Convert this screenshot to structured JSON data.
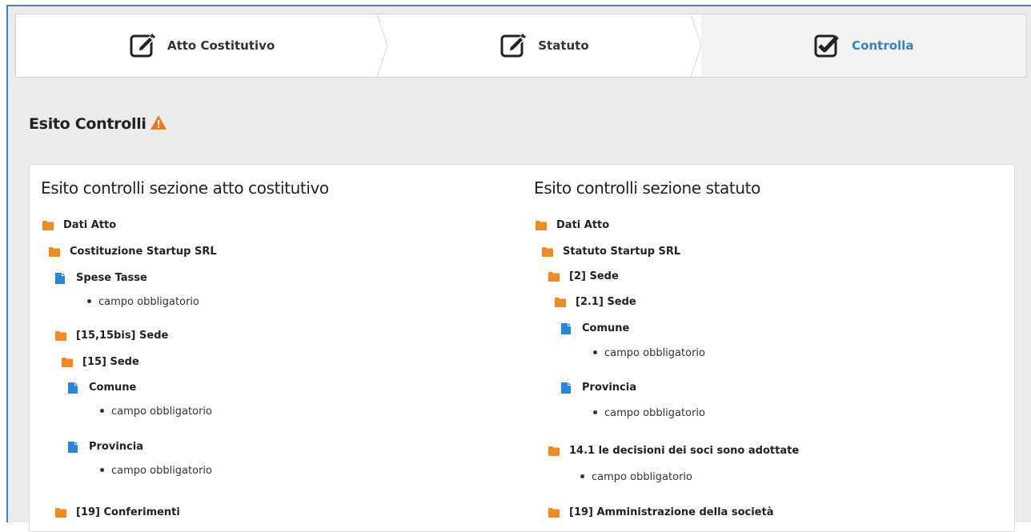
{
  "wizard": {
    "steps": [
      {
        "label": "Atto Costitutivo",
        "icon": "edit-icon"
      },
      {
        "label": "Statuto",
        "icon": "edit-icon"
      },
      {
        "label": "Controlla",
        "icon": "check-square-icon"
      }
    ]
  },
  "page_title": "Esito Controlli",
  "colors": {
    "accent": "#3b7ec1",
    "folder": "#f08a24",
    "file": "#2a86d9",
    "warning": "#f07722"
  },
  "sections": [
    {
      "title": "Esito controlli sezione atto costitutivo",
      "items": [
        {
          "type": "folder",
          "label": "Dati Atto"
        },
        {
          "type": "folder",
          "label": "Costituzione Startup SRL"
        },
        {
          "type": "file",
          "label": "Spese Tasse"
        },
        {
          "type": "bullet",
          "label": "campo obbligatorio"
        },
        {
          "type": "folder",
          "label": "[15,15bis] Sede"
        },
        {
          "type": "folder",
          "label": "[15] Sede"
        },
        {
          "type": "file",
          "label": "Comune"
        },
        {
          "type": "bullet",
          "label": "campo obbligatorio"
        },
        {
          "type": "file",
          "label": "Provincia"
        },
        {
          "type": "bullet",
          "label": "campo obbligatorio"
        },
        {
          "type": "folder",
          "label": "[19] Conferimenti"
        }
      ]
    },
    {
      "title": "Esito controlli sezione statuto",
      "items": [
        {
          "type": "folder",
          "label": "Dati Atto"
        },
        {
          "type": "folder",
          "label": "Statuto Startup SRL"
        },
        {
          "type": "folder",
          "label": "[2] Sede"
        },
        {
          "type": "folder",
          "label": "[2.1] Sede"
        },
        {
          "type": "file",
          "label": "Comune"
        },
        {
          "type": "bullet",
          "label": "campo obbligatorio"
        },
        {
          "type": "file",
          "label": "Provincia"
        },
        {
          "type": "bullet",
          "label": "campo obbligatorio"
        },
        {
          "type": "folder",
          "label": "14.1 le decisioni dei soci sono adottate"
        },
        {
          "type": "bullet",
          "label": "campo obbligatorio"
        },
        {
          "type": "folder",
          "label": "[19] Amministrazione della società"
        }
      ]
    }
  ]
}
